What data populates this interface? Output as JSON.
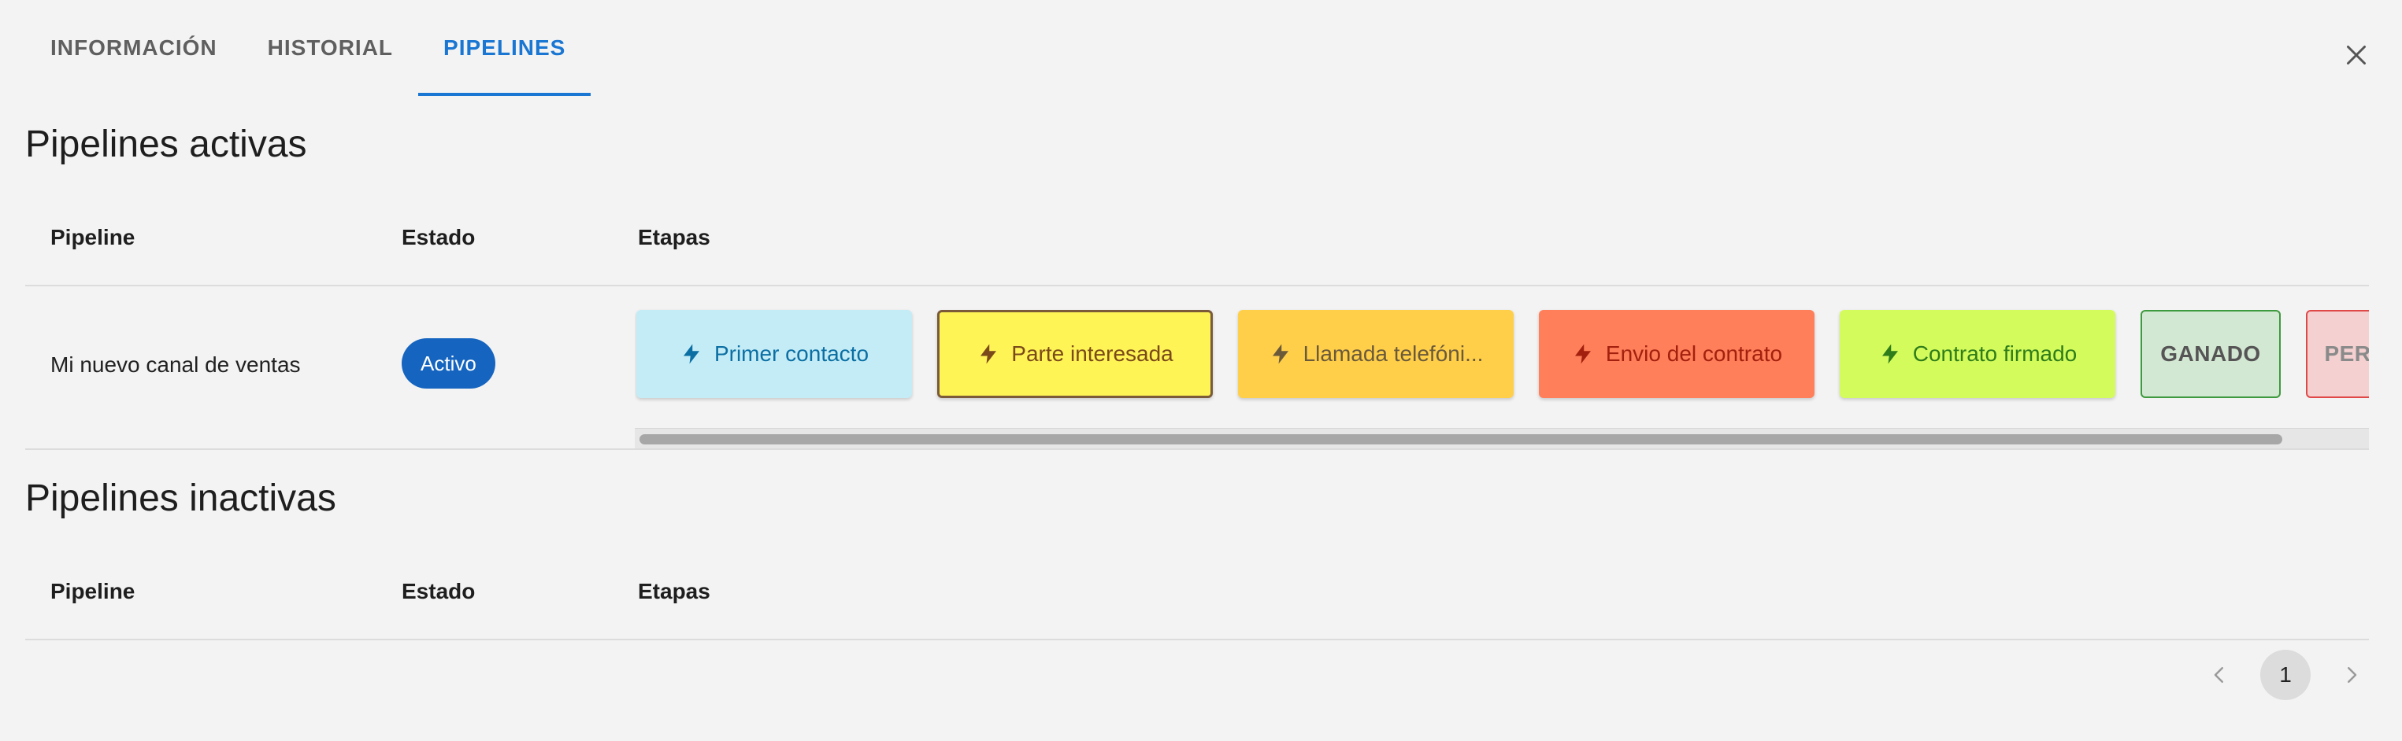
{
  "tabs": [
    {
      "label": "INFORMACIÓN",
      "active": false
    },
    {
      "label": "HISTORIAL",
      "active": false
    },
    {
      "label": "PIPELINES",
      "active": true
    }
  ],
  "icons": {
    "close": "close-icon",
    "stage": "bolt-icon",
    "prev": "chevron-left-icon",
    "next": "chevron-right-icon"
  },
  "active_section": {
    "title": "Pipelines activas",
    "columns": [
      "Pipeline",
      "Estado",
      "Etapas"
    ],
    "rows": [
      {
        "pipeline": "Mi nuevo canal de ventas",
        "estado": "Activo",
        "stages": [
          {
            "label": "Primer contacto",
            "bg": "#c4ecf6",
            "fg": "#0b6fa3",
            "border": "#c4ecf6",
            "icon": true
          },
          {
            "label": "Parte interesada",
            "bg": "#fff455",
            "fg": "#7a4a1a",
            "border": "#7b5a3a",
            "icon": true,
            "selected": true
          },
          {
            "label": "Llamada telefóni...",
            "bg": "#ffcf4a",
            "fg": "#6b5a3a",
            "border": "#ffcf4a",
            "icon": true
          },
          {
            "label": "Envio del contrato",
            "bg": "#ff7f5a",
            "fg": "#a3200e",
            "border": "#ff7f5a",
            "icon": true
          },
          {
            "label": "Contrato firmado",
            "bg": "#d4fb5c",
            "fg": "#2f7d1a",
            "border": "#d4fb5c",
            "icon": true
          },
          {
            "label": "GANADO",
            "bg": "#d3e8d3",
            "fg": "#555555",
            "border": "#3e9a3e",
            "icon": false
          },
          {
            "label": "PERDIDO",
            "bg": "#f4d0d0",
            "fg": "#8a8a8a",
            "border": "#e04848",
            "icon": false
          }
        ]
      }
    ]
  },
  "inactive_section": {
    "title": "Pipelines inactivas",
    "columns": [
      "Pipeline",
      "Estado",
      "Etapas"
    ]
  },
  "pagination": {
    "current_page": "1"
  },
  "colors": {
    "accent": "#1976d2",
    "badge": "#1565c0",
    "background": "#f3f3f3"
  }
}
